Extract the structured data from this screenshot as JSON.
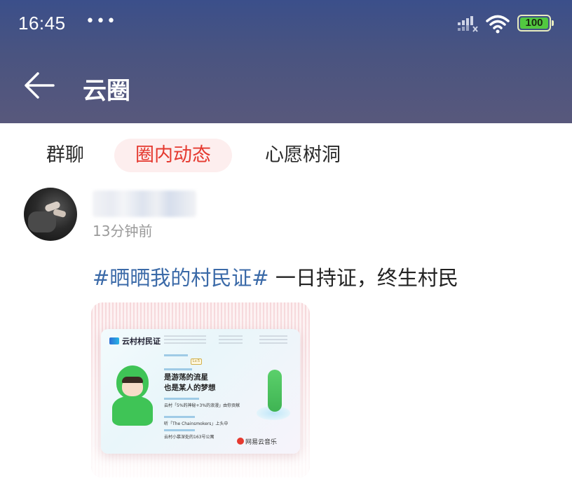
{
  "status_bar": {
    "time": "16:45",
    "dots": "•••",
    "battery": "100"
  },
  "header": {
    "title": "云圈"
  },
  "tabs": [
    {
      "label": "群聊",
      "active": false
    },
    {
      "label": "圈内动态",
      "active": true
    },
    {
      "label": "心愿树洞",
      "active": false
    }
  ],
  "post": {
    "timestamp": "13分钟前",
    "hashtag": "#晒晒我的村民证#",
    "text": " 一日持证，终生村民",
    "card": {
      "title": "云村村民证",
      "level": "Lv.5",
      "identity_line1": "是游荡的流星",
      "identity_line2": "也是某人的梦想",
      "contribution": "云村「5%的神秘+3%的浪漫」由你贡献",
      "pet_phrase": "听「The Chainsmokers」上头中",
      "residence": "云村小慕深处的163号公寓",
      "brand": "网易云音乐"
    }
  },
  "colors": {
    "accent": "#e5392f",
    "hashtag": "#3b6aa8",
    "header_bg": "#46518a"
  }
}
